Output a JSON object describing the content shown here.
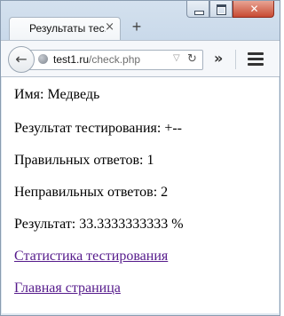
{
  "browser": {
    "tab_title": "Результаты тес...",
    "tab_close": "×",
    "new_tab": "+",
    "url_host": "test1.ru",
    "url_path": "/check.php",
    "overflow": "»",
    "controls": {
      "minimize": "minimize",
      "maximize": "maximize",
      "close": "✕"
    }
  },
  "page": {
    "name": "Имя: Медведь",
    "result_test": "Результат тестирования: +--",
    "correct": "Правильных ответов: 1",
    "incorrect": "Неправильных ответов: 2",
    "result_pct": "Результат: 33.3333333333 %",
    "link_stats": "Статистика тестирования",
    "link_home": "Главная страница"
  },
  "colors": {
    "link": "#551a8b",
    "close_button": "#c74a33"
  }
}
